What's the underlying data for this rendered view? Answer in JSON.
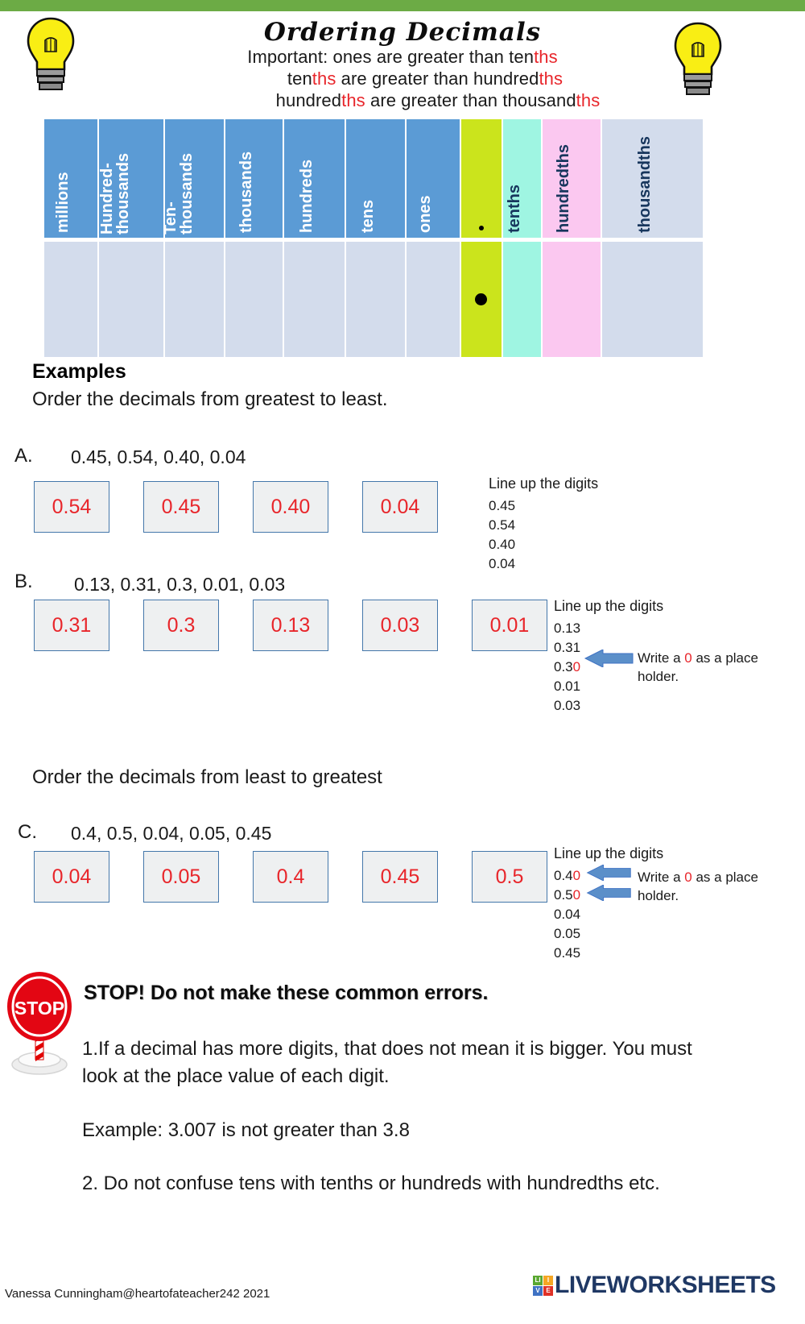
{
  "header": {
    "title": "Ordering  Decimals",
    "lines": [
      {
        "pre": "Important: ones are greater than ten",
        "ths": "ths",
        "post": ""
      },
      {
        "pre": "ten",
        "ths": "ths",
        "post": " are greater than hundred",
        "ths2": "ths"
      },
      {
        "pre": "hundred",
        "ths": "ths",
        "post": " are greater than thousand",
        "ths2": "ths"
      }
    ],
    "icons": [
      "lightbulb-icon",
      "lightbulb-icon"
    ]
  },
  "place_value_chart": {
    "columns": [
      {
        "label": "millions",
        "label2": "",
        "head_color": "#5b9bd5",
        "body_color": "#d3dcec",
        "text_color": "#ffffff"
      },
      {
        "label": "Hundred-",
        "label2": "thousands",
        "head_color": "#5b9bd5",
        "body_color": "#d3dcec",
        "text_color": "#ffffff"
      },
      {
        "label": "Ten-",
        "label2": "thousands",
        "head_color": "#5b9bd5",
        "body_color": "#d3dcec",
        "text_color": "#ffffff"
      },
      {
        "label": "thousands",
        "label2": "",
        "head_color": "#5b9bd5",
        "body_color": "#d3dcec",
        "text_color": "#ffffff"
      },
      {
        "label": "hundreds",
        "label2": "",
        "head_color": "#5b9bd5",
        "body_color": "#d3dcec",
        "text_color": "#ffffff"
      },
      {
        "label": "tens",
        "label2": "",
        "head_color": "#5b9bd5",
        "body_color": "#d3dcec",
        "text_color": "#ffffff"
      },
      {
        "label": "ones",
        "label2": "",
        "head_color": "#5b9bd5",
        "body_color": "#d3dcec",
        "text_color": "#ffffff"
      },
      {
        "label": ".",
        "label2": "",
        "head_color": "#cbe41c",
        "body_color": "#cbe41c",
        "text_color": "#000000"
      },
      {
        "label": "tenths",
        "label2": "",
        "head_color": "#9ff5e2",
        "body_color": "#9ff5e2",
        "text_color": "#17365d"
      },
      {
        "label": "hundredths",
        "label2": "",
        "head_color": "#fbc8f0",
        "body_color": "#fbc8f0",
        "text_color": "#17365d"
      },
      {
        "label": "thousandths",
        "label2": "",
        "head_color": "#d3dcec",
        "body_color": "#d3dcec",
        "text_color": "#17365d"
      }
    ]
  },
  "examples": {
    "heading": "Examples",
    "instruction_greatest": "Order the decimals from greatest to least.",
    "instruction_least": "Order the decimals from least to greatest"
  },
  "questions": [
    {
      "letter": "A.",
      "given": "0.45, 0.54, 0.40, 0.04",
      "answers": [
        "0.54",
        "0.45",
        "0.40",
        "0.04"
      ],
      "note_header": "Line up the digits",
      "note_numbers": [
        {
          "text": "0.45",
          "red_tail": "",
          "arrow": false
        },
        {
          "text": "0.54",
          "red_tail": "",
          "arrow": false
        },
        {
          "text": "0.40",
          "red_tail": "",
          "arrow": false
        },
        {
          "text": "0.04",
          "red_tail": "",
          "arrow": false
        }
      ],
      "arrow_text": ""
    },
    {
      "letter": "B.",
      "given": "0.13, 0.31, 0.3, 0.01, 0.03",
      "answers": [
        "0.31",
        "0.3",
        "0.13",
        "0.03",
        "0.01"
      ],
      "note_header": "Line up the digits",
      "note_numbers": [
        {
          "text": "0.13",
          "red_tail": "",
          "arrow": false
        },
        {
          "text": "0.31",
          "red_tail": "",
          "arrow": false
        },
        {
          "text": "0.3",
          "red_tail": "0",
          "arrow": true
        },
        {
          "text": "0.01",
          "red_tail": "",
          "arrow": false
        },
        {
          "text": "0.03",
          "red_tail": "",
          "arrow": false
        }
      ],
      "arrow_text_pre": "Write a ",
      "arrow_text_zero": "0",
      "arrow_text_post": " as a place",
      "arrow_text_line2": "holder."
    },
    {
      "letter": "C.",
      "given": "0.4, 0.5, 0.04, 0.05, 0.45",
      "answers": [
        "0.04",
        "0.05",
        "0.4",
        "0.45",
        "0.5"
      ],
      "note_header": "Line up the digits",
      "note_numbers": [
        {
          "text": "0.4",
          "red_tail": "0",
          "arrow": true
        },
        {
          "text": "0.5",
          "red_tail": "0",
          "arrow": true
        },
        {
          "text": "0.04",
          "red_tail": "",
          "arrow": false
        },
        {
          "text": "0.05",
          "red_tail": "",
          "arrow": false
        },
        {
          "text": "0.45",
          "red_tail": "",
          "arrow": false
        }
      ],
      "arrow_text_pre": "Write a ",
      "arrow_text_zero": "0",
      "arrow_text_post": " as a place",
      "arrow_text_line2": "holder."
    }
  ],
  "stop_section": {
    "icon": "stop-sign-icon",
    "heading": "STOP! Do not make these common errors.",
    "point1": "1.If a decimal has more digits, that does not mean it is bigger. You must look at the place value of each digit.",
    "point2": "Example: 3.007 is not greater than 3.8",
    "point3": "2. Do not confuse tens with tenths or hundreds with hundredths etc."
  },
  "footer": {
    "credit": "Vanessa Cunningham@heartofateacher242  2021",
    "logo_letters": [
      "LI",
      "I",
      "V",
      "E"
    ],
    "logo_word": "LIVEWORKSHEETS"
  },
  "colors": {
    "green_bar": "#6cab45",
    "header_blue": "#5b9bd5",
    "body_blue": "#d3dcec",
    "lime": "#cbe41c",
    "aqua": "#9ff5e2",
    "pink": "#fbc8f0",
    "red_text": "#e8262b",
    "box_border": "#4477aa",
    "box_fill": "#eef0f1",
    "arrow_blue": "#5b8fc9"
  }
}
